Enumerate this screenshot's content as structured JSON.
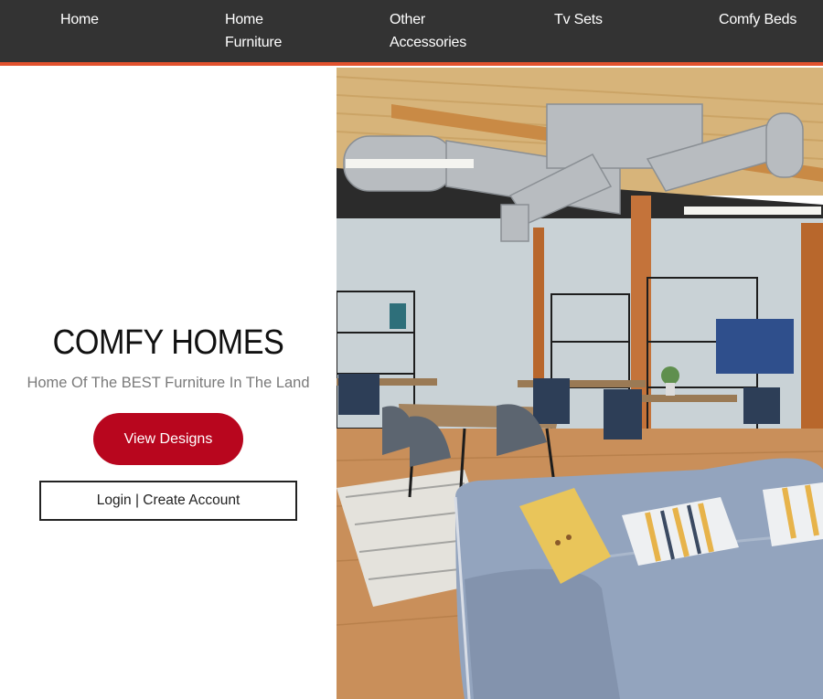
{
  "nav": {
    "items": [
      {
        "lines": [
          "Home"
        ]
      },
      {
        "lines": [
          "Home",
          "Furniture"
        ]
      },
      {
        "lines": [
          "Other",
          "Accessories"
        ]
      },
      {
        "lines": [
          "Tv Sets"
        ]
      },
      {
        "lines": [
          "Comfy Beds"
        ]
      }
    ]
  },
  "hero": {
    "title": "COMFY HOMES",
    "subtitle": "Home Of The BEST Furniture In The Land",
    "view_button": "View Designs",
    "login_button": "Login | Create Account"
  },
  "colors": {
    "nav_bg": "#333333",
    "nav_accent": "#e2522e",
    "primary_button": "#b8061e"
  }
}
